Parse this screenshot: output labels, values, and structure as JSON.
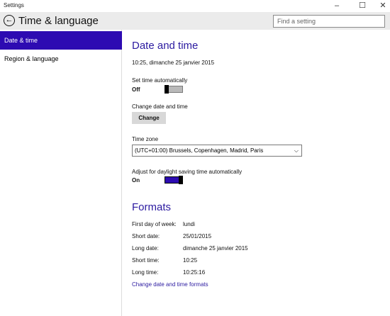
{
  "window": {
    "title": "Settings"
  },
  "header": {
    "page_title": "Time & language",
    "search_placeholder": "Find a setting"
  },
  "sidebar": {
    "items": [
      {
        "label": "Date & time"
      },
      {
        "label": "Region & language"
      }
    ]
  },
  "date_time": {
    "heading": "Date and time",
    "current": "10:25, dimanche 25 janvier 2015",
    "set_auto_label": "Set time automatically",
    "set_auto_state": "Off",
    "change_label": "Change date and time",
    "change_button": "Change",
    "timezone_label": "Time zone",
    "timezone_value": "(UTC+01:00) Brussels, Copenhagen, Madrid, Paris",
    "dst_label": "Adjust for daylight saving time automatically",
    "dst_state": "On"
  },
  "formats": {
    "heading": "Formats",
    "rows": [
      {
        "label": "First day of week:",
        "value": "lundi"
      },
      {
        "label": "Short date:",
        "value": "25/01/2015"
      },
      {
        "label": "Long date:",
        "value": "dimanche 25 janvier 2015"
      },
      {
        "label": "Short time:",
        "value": "10:25"
      },
      {
        "label": "Long time:",
        "value": "10:25:16"
      }
    ],
    "change_link": "Change date and time formats"
  },
  "colors": {
    "accent": "#2d0bb2",
    "heading": "#2b1aa0",
    "toggle_off": "#b9b9b9"
  },
  "icons": {
    "back": "back-arrow-icon",
    "chevron": "chevron-down-icon"
  }
}
